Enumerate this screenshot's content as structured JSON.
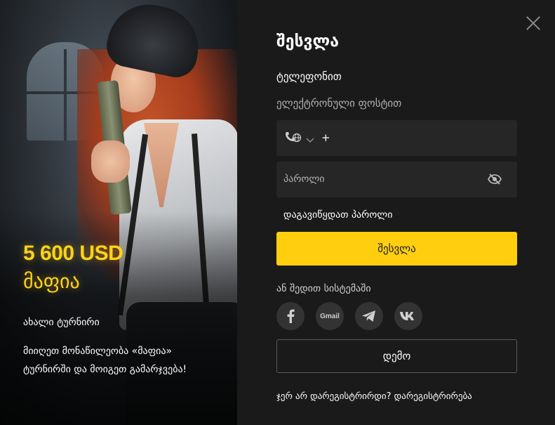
{
  "promo": {
    "amount": "5 600 USD",
    "name": "მაფია",
    "tag": "ახალი ტურნირი",
    "description": "მიიღეთ მონაწილეობა «მაფია» ტურნირში და მოიგეთ გამარჯვება!",
    "accent_color": "#ffd21a"
  },
  "form": {
    "title": "შესვლა",
    "tabs": {
      "phone": "ტელეფონით",
      "email": "ელექტრონული ფოსტით"
    },
    "phone": {
      "prefix": "+"
    },
    "password": {
      "placeholder": "პაროლი"
    },
    "forgot_link": "დაგავიწყდათ პაროლი",
    "login_button": "შესვლა",
    "or_label": "ან შედით სისტემაში",
    "socials": [
      {
        "name": "facebook",
        "label": "f"
      },
      {
        "name": "gmail",
        "label": "Gmail"
      },
      {
        "name": "telegram",
        "label": ""
      },
      {
        "name": "vk",
        "label": "VK"
      }
    ],
    "demo_button": "დემო",
    "register_prompt": "ჯერ არ დარეგისტრირდი?",
    "register_link": "დარეგისტრირება",
    "accent_color": "#ffcf0f"
  },
  "icons": [
    "close-icon",
    "phone-globe-icon",
    "chevron-down-icon",
    "eye-off-icon",
    "facebook-icon",
    "gmail-icon",
    "telegram-icon",
    "vk-icon"
  ]
}
